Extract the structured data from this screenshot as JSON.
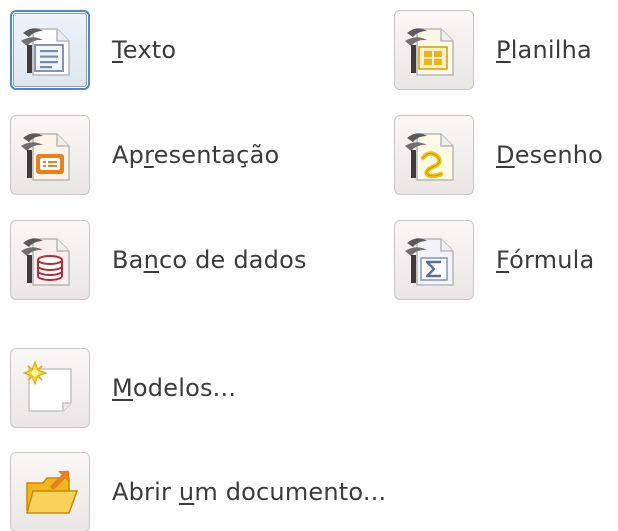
{
  "launcher": {
    "items": [
      {
        "label": "Texto",
        "mnemonic_index": 0,
        "icon": "writer-icon",
        "selected": true
      },
      {
        "label": "Planilha",
        "mnemonic_index": 0,
        "icon": "calc-icon",
        "selected": false
      },
      {
        "label": "Apresentação",
        "mnemonic_index": 2,
        "icon": "impress-icon",
        "selected": false
      },
      {
        "label": "Desenho",
        "mnemonic_index": 0,
        "icon": "draw-icon",
        "selected": false
      },
      {
        "label": "Banco de dados",
        "mnemonic_index": 2,
        "icon": "base-icon",
        "selected": false
      },
      {
        "label": "Fórmula",
        "mnemonic_index": 0,
        "icon": "math-icon",
        "selected": false
      },
      {
        "label": "Modelos...",
        "mnemonic_index": 0,
        "icon": "templates-icon",
        "selected": false
      },
      {
        "label": "Abrir um documento...",
        "mnemonic_index": 6,
        "icon": "open-folder-icon",
        "selected": false
      }
    ]
  },
  "colors": {
    "selected_border": "#4a8bd0",
    "label_text": "#3b3b3b",
    "writer_accent": "#6f89b8",
    "calc_accent": "#f0b21a",
    "impress_accent": "#e8801e",
    "draw_accent": "#f2c21b",
    "base_accent": "#b52a35",
    "math_accent": "#7f96c0",
    "templates_accent": "#f6d82a",
    "folder_accent": "#f2b71d"
  }
}
